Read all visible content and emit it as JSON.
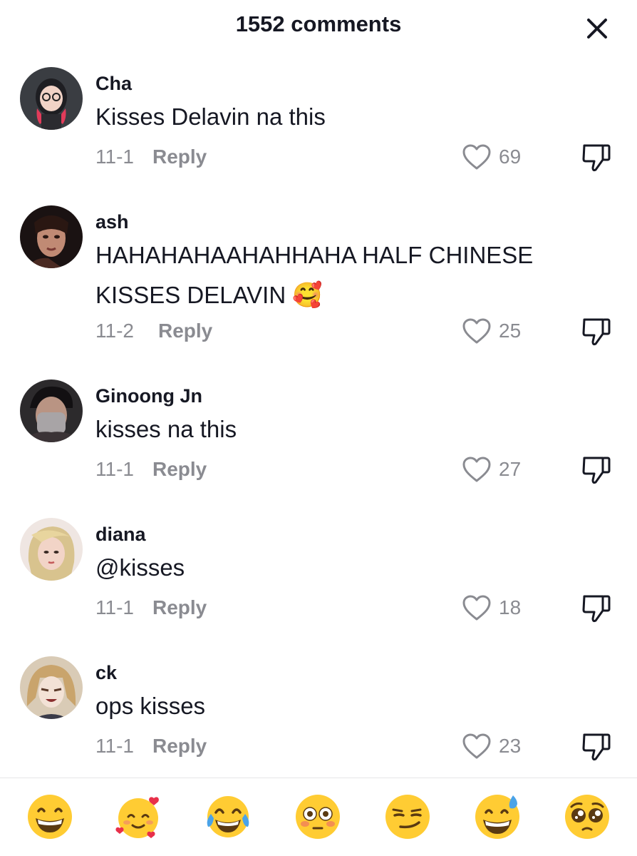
{
  "header": {
    "title": "1552 comments",
    "close_icon": "close-icon"
  },
  "comments": [
    {
      "username": "Cha",
      "text": "Kisses Delavin na this",
      "emoji": "",
      "date": "11-1",
      "reply_label": "Reply",
      "likes": "69"
    },
    {
      "username": "ash",
      "text": "HAHAHAHAAHAHHAHA HALF CHINESE KISSES DELAVIN",
      "emoji": "🥰",
      "date": "11-2",
      "reply_label": "Reply",
      "likes": "25"
    },
    {
      "username": "Ginoong Jn",
      "text": "kisses na this",
      "emoji": "",
      "date": "11-1",
      "reply_label": "Reply",
      "likes": "27"
    },
    {
      "username": "diana",
      "text": "@kisses",
      "emoji": "",
      "date": "11-1",
      "reply_label": "Reply",
      "likes": "18"
    },
    {
      "username": "ck",
      "text": "ops kisses",
      "emoji": "",
      "date": "11-1",
      "reply_label": "Reply",
      "likes": "23"
    }
  ],
  "emoji_bar": [
    {
      "name": "grinning-face",
      "glyph": "😁"
    },
    {
      "name": "smiling-face-with-hearts",
      "glyph": "🥰"
    },
    {
      "name": "face-with-tears-of-joy",
      "glyph": "😂"
    },
    {
      "name": "flushed-face",
      "glyph": "😳"
    },
    {
      "name": "smirking-face",
      "glyph": "😏"
    },
    {
      "name": "grinning-face-with-sweat",
      "glyph": "😅"
    },
    {
      "name": "pleading-face",
      "glyph": "🥺"
    }
  ],
  "colors": {
    "text_primary": "#161823",
    "text_secondary": "#8a8b91",
    "emoji_yellow": "#ffcc33"
  }
}
